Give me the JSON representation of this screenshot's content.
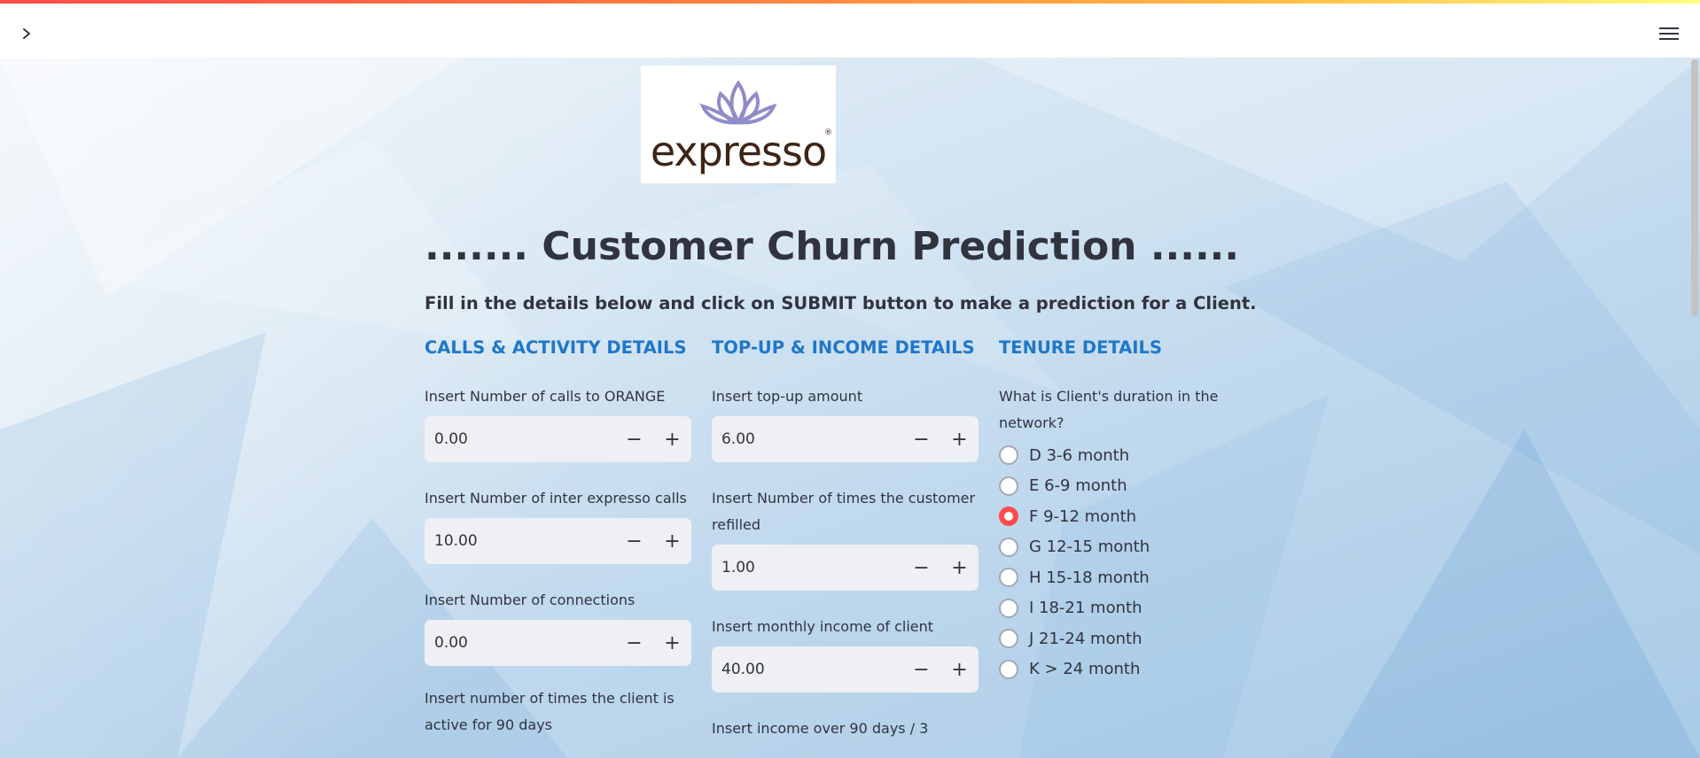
{
  "topbar": {
    "sidebar_toggle_icon": "chevron-right-icon",
    "menu_icon": "hamburger-menu-icon"
  },
  "logo": {
    "text": "expresso",
    "registered": "®",
    "colors": {
      "flower": "#8f8cc9",
      "word": "#3d2414"
    }
  },
  "header": {
    "title": "....... Customer Churn Prediction ......",
    "subtitle": "Fill in the details below and click on SUBMIT button to make a prediction for a Client."
  },
  "columns": {
    "calls": {
      "heading": "CALLS & ACTIVITY DETAILS",
      "fields": [
        {
          "label": "Insert Number of calls to ORANGE",
          "value": "0.00"
        },
        {
          "label": "Insert Number of inter expresso calls",
          "value": "10.00"
        },
        {
          "label": "Insert Number of connections",
          "value": "0.00"
        },
        {
          "label": "Insert number of times the client is active for 90 days"
        }
      ]
    },
    "topup": {
      "heading": "TOP-UP & INCOME DETAILS",
      "fields": [
        {
          "label": "Insert top-up amount",
          "value": "6.00"
        },
        {
          "label": "Insert Number of times the customer refilled",
          "value": "1.00"
        },
        {
          "label": "Insert monthly income of client",
          "value": "40.00"
        },
        {
          "label": "Insert income over 90 days / 3"
        }
      ]
    },
    "tenure": {
      "heading": "TENURE DETAILS",
      "question": "What is Client's duration in the network?",
      "options": [
        "D 3-6 month",
        "E 6-9 month",
        "F 9-12 month",
        "G 12-15 month",
        "H 15-18 month",
        "I 18-21 month",
        "J 21-24 month",
        "K > 24 month"
      ],
      "selected": "F 9-12 month"
    }
  },
  "stepper": {
    "minus": "−",
    "plus": "+"
  },
  "colors": {
    "accent": "#ff4b4b",
    "heading_blue": "#1f77c9",
    "text": "#31333f",
    "input_bg": "#eff0f4"
  }
}
